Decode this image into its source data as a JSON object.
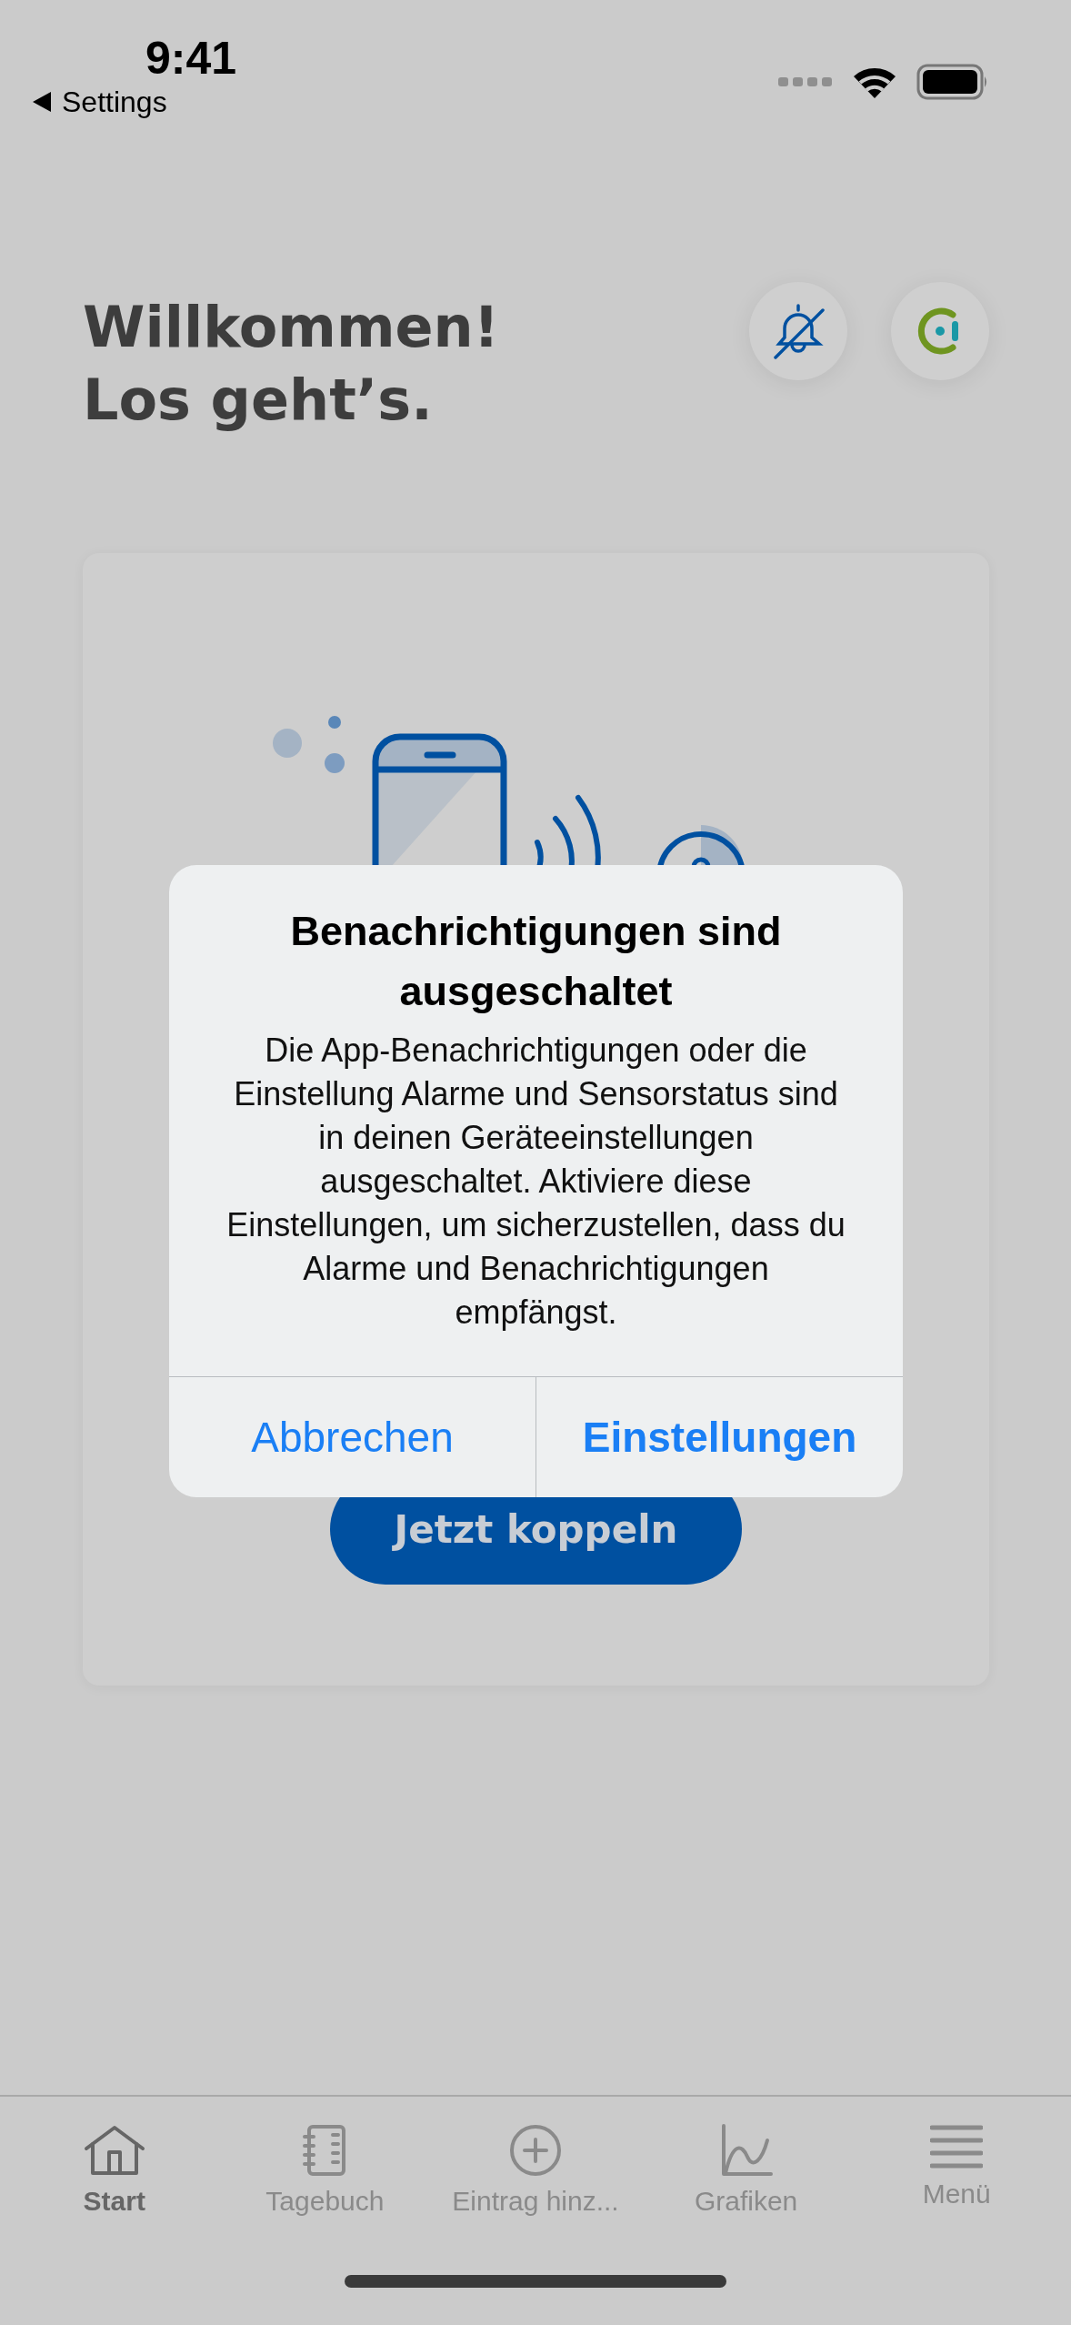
{
  "status_bar": {
    "time": "9:41",
    "back_label": "Settings"
  },
  "header": {
    "title_lines": [
      "Willkommen!",
      "Los geht’s."
    ]
  },
  "card": {
    "button": "Jetzt koppeln"
  },
  "dialog": {
    "title": "Benachrichtigungen sind ausgeschaltet",
    "message": "Die App-Benachrichtigungen oder die Einstellung Alarme und Sensorstatus sind in deinen Geräteeinstellungen ausgeschaltet. Aktiviere diese Einstellungen, um sicherzustellen, dass du Alarme und Benachrichtigungen empfängst.",
    "buttons": [
      {
        "label": "Abbrechen",
        "kind": "cancel"
      },
      {
        "label": "Einstellungen",
        "kind": "default"
      }
    ]
  },
  "tabs": [
    {
      "label": "Start",
      "kind": "home",
      "selected": true
    },
    {
      "label": "Tagebuch",
      "kind": "book",
      "selected": false
    },
    {
      "label": "Eintrag hinz...",
      "kind": "add",
      "selected": false
    },
    {
      "label": "Grafiken",
      "kind": "chart",
      "selected": false
    },
    {
      "label": "Menü",
      "kind": "menu",
      "selected": false
    }
  ]
}
